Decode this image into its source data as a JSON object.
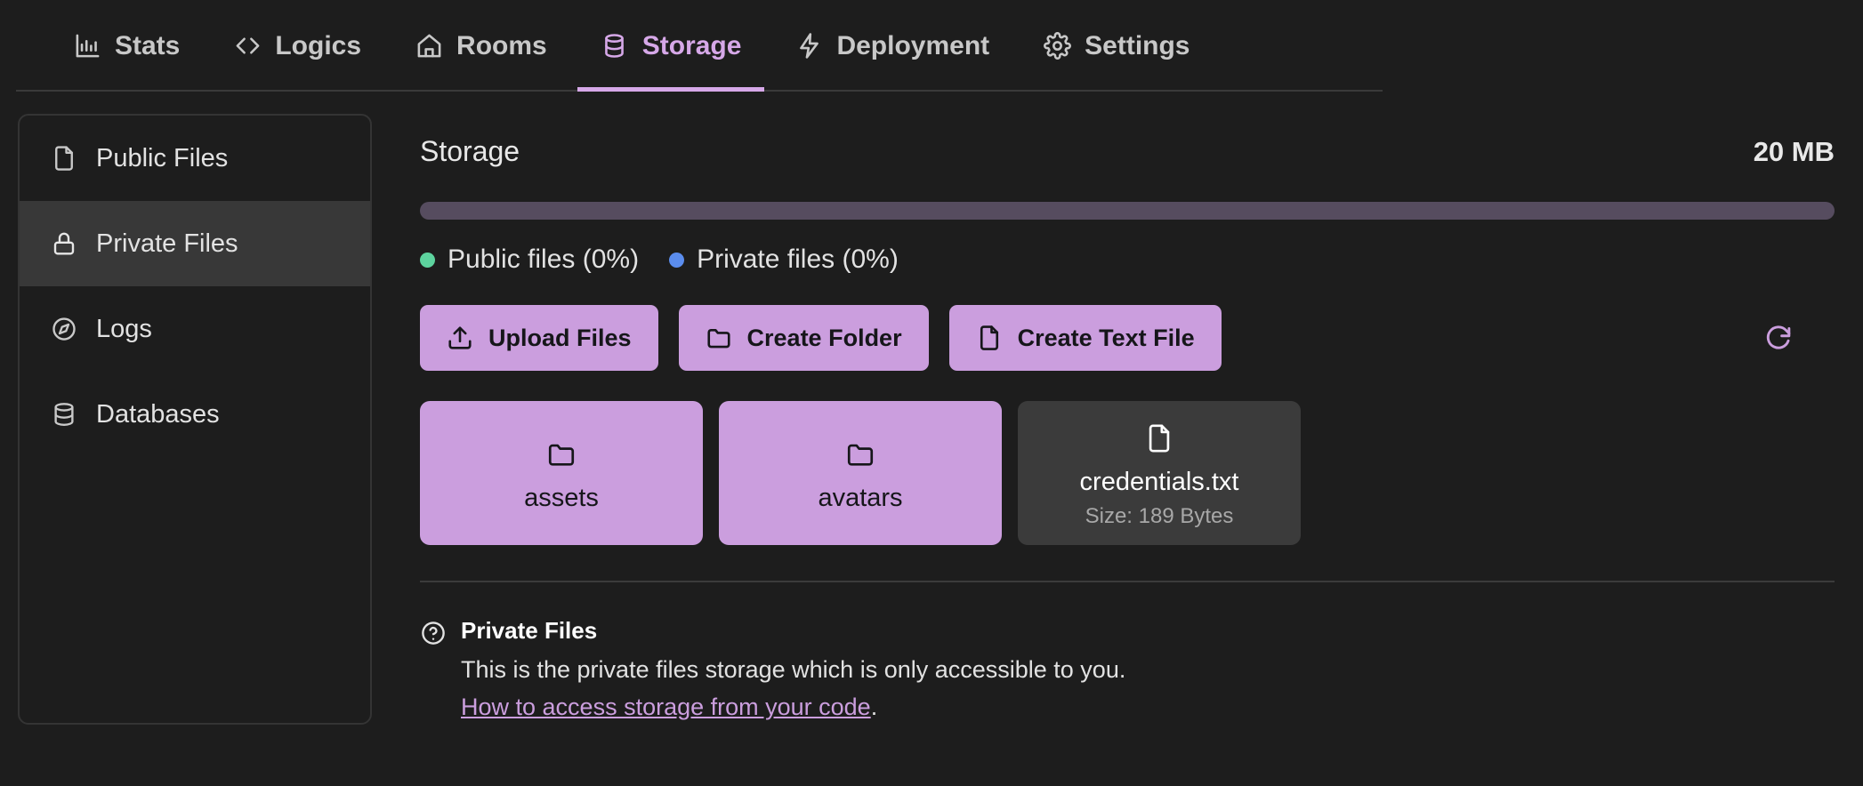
{
  "nav": {
    "tabs": [
      {
        "label": "Stats",
        "icon": "bar-chart-icon",
        "active": false
      },
      {
        "label": "Logics",
        "icon": "code-icon",
        "active": false
      },
      {
        "label": "Rooms",
        "icon": "home-icon",
        "active": false
      },
      {
        "label": "Storage",
        "icon": "database-icon",
        "active": true
      },
      {
        "label": "Deployment",
        "icon": "lightning-icon",
        "active": false
      },
      {
        "label": "Settings",
        "icon": "gear-icon",
        "active": false
      }
    ],
    "active_color": "#d6a8e8"
  },
  "sidebar": {
    "items": [
      {
        "label": "Public Files",
        "icon": "file-icon",
        "selected": false
      },
      {
        "label": "Private Files",
        "icon": "lock-icon",
        "selected": true
      },
      {
        "label": "Logs",
        "icon": "compass-icon",
        "selected": false
      },
      {
        "label": "Databases",
        "icon": "database-icon",
        "selected": false
      }
    ]
  },
  "storage": {
    "title": "Storage",
    "total_size": "20 MB",
    "progress_percent": 0,
    "legend": [
      {
        "label": "Public files (0%)",
        "color": "#5dd39e"
      },
      {
        "label": "Private files (0%)",
        "color": "#5b8dee"
      }
    ]
  },
  "toolbar": {
    "upload_label": "Upload Files",
    "create_folder_label": "Create Folder",
    "create_text_file_label": "Create Text File",
    "refresh_icon": "refresh-icon",
    "button_color": "#cb9ede"
  },
  "files": [
    {
      "type": "folder",
      "name": "assets",
      "size": ""
    },
    {
      "type": "folder",
      "name": "avatars",
      "size": ""
    },
    {
      "type": "file",
      "name": "credentials.txt",
      "size": "Size: 189 Bytes"
    }
  ],
  "help": {
    "title": "Private Files",
    "description": "This is the private files storage which is only accessible to you.",
    "link_text": "How to access storage from your code",
    "link_suffix": "."
  }
}
